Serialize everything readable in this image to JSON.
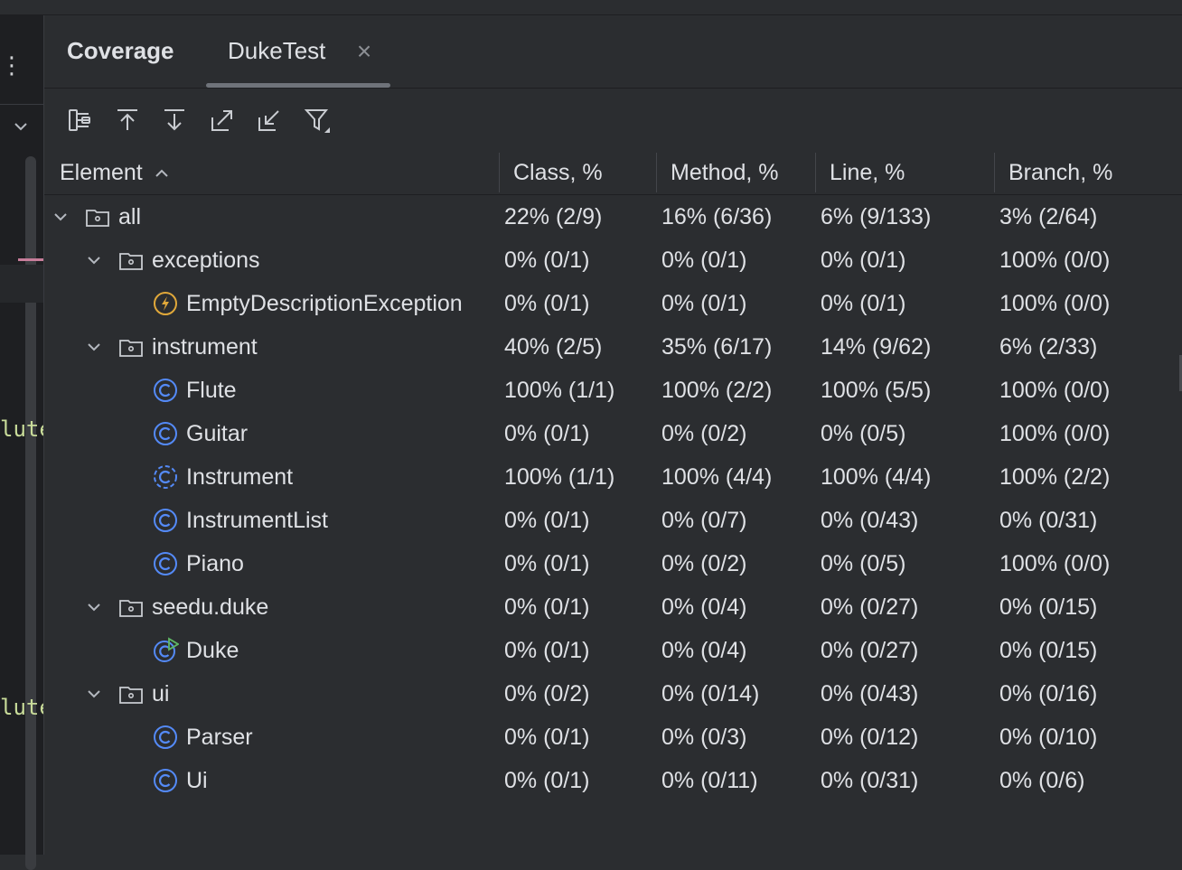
{
  "tabs": {
    "tool_window_title": "Coverage",
    "active_tab": "DukeTest",
    "close_glyph": "×"
  },
  "gutter": {
    "kebab_glyph": "⋮",
    "code_fragment_1": "lute",
    "code_fragment_2": "lute"
  },
  "toolbar": {
    "icons": [
      "flatten-packages-icon",
      "navigate-up-icon",
      "navigate-down-icon",
      "expand-all-icon",
      "collapse-all-icon",
      "filter-icon"
    ]
  },
  "columns": {
    "element": "Element",
    "class": "Class, %",
    "method": "Method, %",
    "line": "Line, %",
    "branch": "Branch, %"
  },
  "colors": {
    "background": "#2b2d30",
    "text": "#dfe1e5",
    "class_icon": "#548af7",
    "exception_icon": "#e0a83a",
    "run_marker": "#5fb865"
  },
  "rows": [
    {
      "name": "all",
      "icon": "package-icon",
      "expanded": true,
      "class": "22% (2/9)",
      "method": "16% (6/36)",
      "line": "6% (9/133)",
      "branch": "3% (2/64)"
    },
    {
      "name": "exceptions",
      "icon": "package-icon",
      "expanded": true,
      "class": "0% (0/1)",
      "method": "0% (0/1)",
      "line": "0% (0/1)",
      "branch": "100% (0/0)"
    },
    {
      "name": "EmptyDescriptionException",
      "icon": "exception-class-icon",
      "class": "0% (0/1)",
      "method": "0% (0/1)",
      "line": "0% (0/1)",
      "branch": "100% (0/0)"
    },
    {
      "name": "instrument",
      "icon": "package-icon",
      "expanded": true,
      "class": "40% (2/5)",
      "method": "35% (6/17)",
      "line": "14% (9/62)",
      "branch": "6% (2/33)"
    },
    {
      "name": "Flute",
      "icon": "class-icon",
      "class": "100% (1/1)",
      "method": "100% (2/2)",
      "line": "100% (5/5)",
      "branch": "100% (0/0)"
    },
    {
      "name": "Guitar",
      "icon": "class-icon",
      "class": "0% (0/1)",
      "method": "0% (0/2)",
      "line": "0% (0/5)",
      "branch": "100% (0/0)"
    },
    {
      "name": "Instrument",
      "icon": "abstract-class-icon",
      "class": "100% (1/1)",
      "method": "100% (4/4)",
      "line": "100% (4/4)",
      "branch": "100% (2/2)"
    },
    {
      "name": "InstrumentList",
      "icon": "class-icon",
      "class": "0% (0/1)",
      "method": "0% (0/7)",
      "line": "0% (0/43)",
      "branch": "0% (0/31)"
    },
    {
      "name": "Piano",
      "icon": "class-icon",
      "class": "0% (0/1)",
      "method": "0% (0/2)",
      "line": "0% (0/5)",
      "branch": "100% (0/0)"
    },
    {
      "name": "seedu.duke",
      "icon": "package-icon",
      "expanded": true,
      "class": "0% (0/1)",
      "method": "0% (0/4)",
      "line": "0% (0/27)",
      "branch": "0% (0/15)"
    },
    {
      "name": "Duke",
      "icon": "runnable-class-icon",
      "class": "0% (0/1)",
      "method": "0% (0/4)",
      "line": "0% (0/27)",
      "branch": "0% (0/15)"
    },
    {
      "name": "ui",
      "icon": "package-icon",
      "expanded": true,
      "class": "0% (0/2)",
      "method": "0% (0/14)",
      "line": "0% (0/43)",
      "branch": "0% (0/16)"
    },
    {
      "name": "Parser",
      "icon": "class-icon",
      "class": "0% (0/1)",
      "method": "0% (0/3)",
      "line": "0% (0/12)",
      "branch": "0% (0/10)"
    },
    {
      "name": "Ui",
      "icon": "class-icon",
      "class": "0% (0/1)",
      "method": "0% (0/11)",
      "line": "0% (0/31)",
      "branch": "0% (0/6)"
    }
  ]
}
